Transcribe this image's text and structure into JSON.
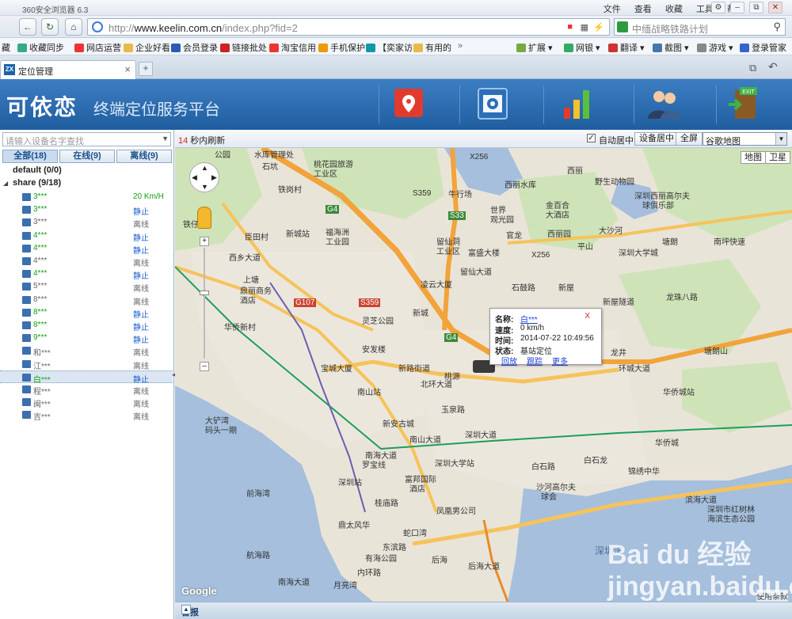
{
  "browser": {
    "title": "360安全浏览器 6.3",
    "menus": [
      "文件",
      "查看",
      "收藏",
      "工具",
      "帮助"
    ],
    "address": {
      "domain": "www.keelin.com.cn",
      "path": "/index.php?fid=2",
      "prefix": "http://"
    },
    "search_placeholder": "中缅战略铁路计划",
    "favorites": [
      {
        "label": "藏",
        "color": "#c45"
      },
      {
        "label": "收藏同步",
        "color": "#3a8"
      },
      {
        "label": "网店运营",
        "color": "#e33"
      },
      {
        "label": "企业好看",
        "color": "#e9b949"
      },
      {
        "label": "会员登录",
        "color": "#2a5db0"
      },
      {
        "label": "链接批处",
        "color": "#c22"
      },
      {
        "label": "淘宝信用",
        "color": "#e33"
      },
      {
        "label": "手机保护",
        "color": "#e90"
      },
      {
        "label": "【奕家访",
        "color": "#19a"
      },
      {
        "label": "有用的",
        "color": "#e9b949"
      }
    ],
    "favorites_right": [
      {
        "label": "扩展",
        "color": "#7a4"
      },
      {
        "label": "网银",
        "color": "#3a6"
      },
      {
        "label": "翻译",
        "color": "#c33"
      },
      {
        "label": "截图",
        "color": "#47a"
      },
      {
        "label": "游戏",
        "color": "#888"
      },
      {
        "label": "登录管家",
        "color": "#36c"
      }
    ],
    "tab_label": "定位管理",
    "tab_logo": "ZX"
  },
  "app": {
    "brand": "可依恋",
    "subtitle": "终端定位服务平台",
    "header_icons": [
      "map-pin-icon",
      "settings-gear-icon",
      "bar-chart-icon",
      "users-icon",
      "exit-door-icon"
    ]
  },
  "sidebar": {
    "search_placeholder": "请输入设备名字查找",
    "filter_tabs": [
      "全部(18)",
      "在线(9)",
      "离线(9)"
    ],
    "groups": [
      {
        "label": "default (0/0)"
      },
      {
        "label": "share (9/18)"
      }
    ],
    "devices": [
      {
        "name": "3***",
        "status": "20 Km/H",
        "state": "moving"
      },
      {
        "name": "3***",
        "status": "静止",
        "state": "still"
      },
      {
        "name": "3***",
        "status": "离线",
        "state": "offline"
      },
      {
        "name": "4***",
        "status": "静止",
        "state": "still"
      },
      {
        "name": "4***",
        "status": "静止",
        "state": "still"
      },
      {
        "name": "4***",
        "status": "离线",
        "state": "offline"
      },
      {
        "name": "4***",
        "status": "静止",
        "state": "still"
      },
      {
        "name": "5***",
        "status": "离线",
        "state": "offline"
      },
      {
        "name": "8***",
        "status": "离线",
        "state": "offline"
      },
      {
        "name": "8***",
        "status": "静止",
        "state": "still"
      },
      {
        "name": "8***",
        "status": "静止",
        "state": "still"
      },
      {
        "name": "9***",
        "status": "静止",
        "state": "still"
      },
      {
        "name": "和***",
        "status": "离线",
        "state": "offline"
      },
      {
        "name": "江***",
        "status": "离线",
        "state": "offline"
      },
      {
        "name": "白***",
        "status": "静止",
        "state": "still",
        "selected": true
      },
      {
        "name": "程***",
        "status": "离线",
        "state": "offline"
      },
      {
        "name": "闽***",
        "status": "离线",
        "state": "offline"
      },
      {
        "name": "吉***",
        "status": "离线",
        "state": "offline"
      }
    ]
  },
  "map_toolbar": {
    "refresh_seconds": "14",
    "refresh_text": "秒内刷新",
    "auto_center_label": "自动居中",
    "auto_center_checked": true,
    "center_button": "设备居中",
    "fullscreen_button": "全屏",
    "map_select": "谷歌地图"
  },
  "map": {
    "type_buttons": [
      "地图",
      "卫星"
    ],
    "google_logo": "Google",
    "terms": "使用条款",
    "popup": {
      "name_label": "名称:",
      "name_value": "白***",
      "speed_label": "速度:",
      "speed_value": "0 km/h",
      "time_label": "时间:",
      "time_value": "2014-07-22 10:49:56",
      "state_label": "状态:",
      "state_value": "基站定位",
      "actions": [
        "回放",
        "跟踪",
        "更多"
      ],
      "close": "X"
    },
    "labels": [
      "公园",
      "水库管理处",
      "石坑",
      "桃花园旅游",
      "工业区",
      "铁岗村",
      "X256",
      "S359",
      "牛行场",
      "西丽水库",
      "西丽",
      "野生动物园",
      "深圳西丽高尔夫",
      "球俱乐部",
      "铁仔山",
      "臣田村",
      "新城站",
      "福海洲",
      "工业园",
      "G4",
      "S33",
      "留仙洞",
      "工业区",
      "世界",
      "观光园",
      "金百合",
      "大酒店",
      "西丽园",
      "官龙",
      "大沙河",
      "平山",
      "塘朗",
      "南坪快速",
      "西乡大道",
      "富盛大楼",
      "X256",
      "深圳大学城",
      "上塘",
      "鼎丽商务",
      "酒店",
      "留仙大道",
      "凌云大厦",
      "石鼓路",
      "新屋",
      "新屋隧道",
      "龙珠八路",
      "G107",
      "S359",
      "新城",
      "灵芝公园",
      "华侨新村",
      "宝城大厦",
      "安发楼",
      "新路街道",
      "北环大道",
      "G4",
      "龙井",
      "环城大道",
      "华侨城站",
      "大铲湾",
      "码头一期",
      "新安古城",
      "玉泉路",
      "深圳大道",
      "南山站",
      "桃源",
      "华侨城",
      "前海湾",
      "南海大道",
      "南山大道",
      "罗宝线",
      "深圳站",
      "深圳大学站",
      "白石路",
      "白石龙",
      "锦绣中华",
      "富邦国际",
      "酒店",
      "沙河高尔夫",
      "球会",
      "滨海大道",
      "深圳市红树林",
      "海滨生态公园",
      "桂庙路",
      "凤凰男公司",
      "鼎太风华",
      "东滨路",
      "蛇口湾",
      "内环路",
      "航海路",
      "南海大道",
      "月亮湾",
      "后海",
      "有海公园",
      "后海大道",
      "深圳湾",
      "塘朗山"
    ]
  },
  "alarm_bar": {
    "label": "警报"
  },
  "watermark": "Bai du 经验 jingyan.baidu.com"
}
